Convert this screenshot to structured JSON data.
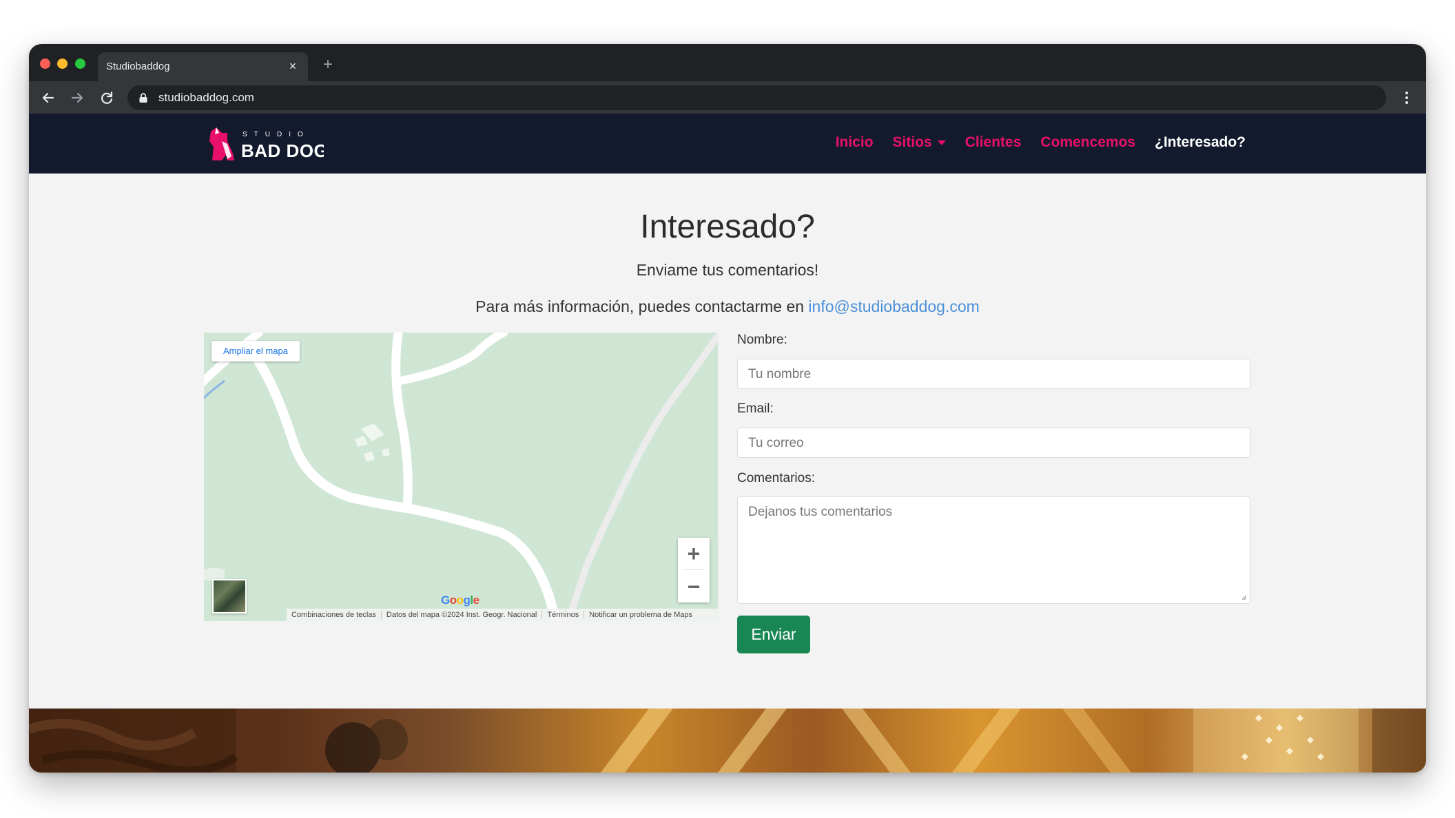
{
  "browser": {
    "tab_title": "Studiobaddog",
    "tab_close": "×",
    "new_tab": "+",
    "url": "studiobaddog.com"
  },
  "site": {
    "logo_text_top": "STUDIO",
    "logo_text_main": "BAD DOG",
    "nav": [
      {
        "label": "Inicio"
      },
      {
        "label": "Sitios"
      },
      {
        "label": "Clientes"
      },
      {
        "label": "Comencemos"
      },
      {
        "label": "¿Interesado?"
      }
    ],
    "accent_color": "#e8106a",
    "nav_background": "#141a2e"
  },
  "main": {
    "heading": "Interesado?",
    "subheading": "Enviame tus comentarios!",
    "contact_text": "Para más información, puedes contactarme en",
    "contact_email": "info@studiobaddog.com"
  },
  "map": {
    "expand_label": "Ampliar el mapa",
    "zoom_in": "+",
    "zoom_out": "−",
    "google_logo": [
      "G",
      "o",
      "o",
      "g",
      "l",
      "e"
    ],
    "attribution": [
      "Combinaciones de teclas",
      "Datos del mapa ©2024 Inst. Geogr. Nacional",
      "Términos",
      "Notificar un problema de Maps"
    ]
  },
  "form": {
    "name_label": "Nombre:",
    "name_placeholder": "Tu nombre",
    "email_label": "Email:",
    "email_placeholder": "Tu correo",
    "comments_label": "Comentarios:",
    "comments_placeholder": "Dejanos tus comentarios",
    "submit_label": "Enviar",
    "submit_color": "#198754"
  }
}
